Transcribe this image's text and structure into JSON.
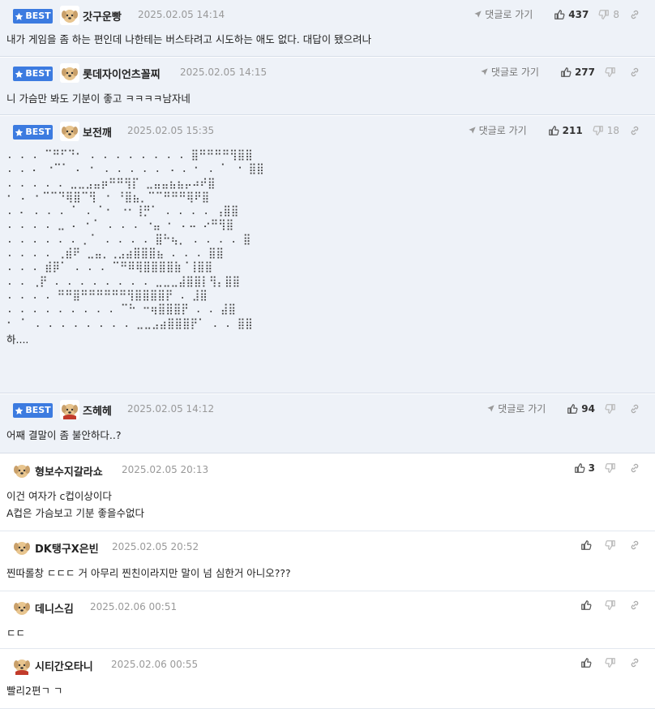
{
  "comments": [
    {
      "best": true,
      "badge": "BEST",
      "nick": "갓구운빵",
      "date": "2025.02.05 14:14",
      "goto": "댓글로 가기",
      "up": "437",
      "down": "8",
      "text": "내가 게임을 좀 하는 편인데 나한테는 버스타려고 시도하는 애도 없다. 대답이 됐으려나"
    },
    {
      "best": true,
      "badge": "BEST",
      "nick": "롯데자이언츠꼴찌",
      "date": "2025.02.05 14:15",
      "goto": "댓글로 가기",
      "up": "277",
      "down": "",
      "text": "니 가슴만 봐도 기분이 좋고 ㅋㅋㅋㅋ남자네"
    },
    {
      "best": true,
      "badge": "BEST",
      "nick": "보전깨",
      "date": "2025.02.05 15:35",
      "goto": "댓글로 가기",
      "up": "211",
      "down": "18",
      "art": [
        ". . . ⠉⠛⠋⠙⠂ . . . . . . . . ⣿⠛⠛⠛⠛⢻⣿⣿",
        ". . ⠄ ⠐⠉⠁ ⠄ ⠂ . . . . . ⠠ . ⠂ . ⠁ ⠐ ⣿⣿",
        ". . . . . ⣀⣀⣠⣤⡶⠛⠛⢻⡏ ⣀⣤⣤⣦⣦⡤⠴⠞⣿",
        "⠂ ⠄ ⠂⠉⠉⠙⢿⣿⠉⢻ ⠐ ⠘⣿⣦⡀⠉⠉⠛⠛⠛⢿⠟⣿",
        ". ⠄ . . . ⠁ . ⠁⠂ ⠐⠂⢸⡛⠁ . . . . ⢠⣿⣿",
        ". . . . ⣀ ⠄ ⠂⠁ . . . ⠐⣤ ⠂ ⠄⠤ ⠔⠛⢻⣿",
        ". . . . . . ⡀⠁ . . . . ⣿⠓⢦⡀ . . . . ⣿",
        ". . . . ⢀⣾⠟ ⣀⣤⡀⢀⣠⣴⣿⣿⣿⣦ . . . ⣿⣿",
        ". . . ⣾⡿⠁ . . . ⠉⠛⠿⢿⣿⣿⣿⣿⣷⠈⢸⣿⣿",
        ". . ⢀⡟ . . . . . . . . ⣀⣀⣀⣼⣿⣿⡇⢻⡄⣿⣿",
        ". . . . ⠛⠛⣿⠛⠛⠛⠛⠛⠛⢻⣿⣿⣿⣿⡟ . ⣸⣿",
        ". . . . . . . . . ⠉⠓ ⠒⢶⣿⣿⣿⡟ . . ⣼⣿",
        "⠂ ⠁ . . . . . . . . ⣀⣀⣠⣴⣿⣿⣿⡟⠁ . . ⣿⣿"
      ],
      "text": "하...."
    },
    {
      "best": true,
      "badge": "BEST",
      "nick": "즈헤헤",
      "date": "2025.02.05 14:12",
      "goto": "댓글로 가기",
      "up": "94",
      "down": "",
      "text": "어째 결말이 좀 불안하다..?"
    },
    {
      "best": false,
      "nick": "형보수지갈라쇼",
      "date": "2025.02.05 20:13",
      "up": "3",
      "down": "",
      "text": "이건 여자가 c컵이상이다\nA컵은 가슴보고 기분 좋을수없다"
    },
    {
      "best": false,
      "nick": "DK탱구X은빈",
      "date": "2025.02.05 20:52",
      "up": "",
      "down": "",
      "text": "찐따롤창 ㄷㄷㄷ 거 아무리 찐친이라지만 말이 넘 심한거 아니오???"
    },
    {
      "best": false,
      "nick": "데니스김",
      "date": "2025.02.06 00:51",
      "up": "",
      "down": "",
      "text": "ㄷㄷ"
    },
    {
      "best": false,
      "nick": "시티간오타니",
      "date": "2025.02.06 00:55",
      "up": "",
      "down": "",
      "text": "빨리2편ㄱ ㄱ"
    }
  ],
  "colors": {
    "best_bg": "#eef2f8",
    "badge": "#3c7be0",
    "text": "#222222",
    "meta": "#999999"
  },
  "icons": [
    "star-icon",
    "arrow-icon",
    "thumbs-up-icon",
    "thumbs-down-icon",
    "link-icon",
    "dog-avatar"
  ]
}
